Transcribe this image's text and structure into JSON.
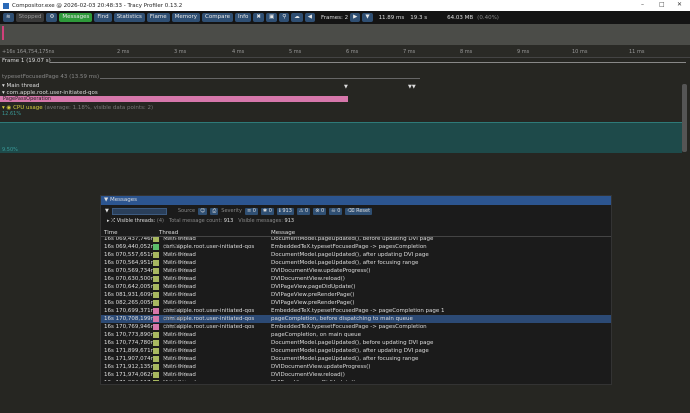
{
  "window": {
    "title": "Compositor.exe @ 2026-02-03 20:48:33 - Tracy Profiler 0.13.2",
    "minimize": "–",
    "maximize": "□",
    "close": "✕"
  },
  "toolbar": {
    "stopped": "Stopped",
    "messages": "Messages",
    "find": "Find",
    "statistics": "Statistics",
    "flame": "Flame",
    "memory": "Memory",
    "compare": "Compare",
    "info": "Info",
    "frames": "Frames: 2",
    "frame_time": "11.89 ms",
    "total_time": "19.3 s",
    "memory_usage": "64.03 MB",
    "memory_pct": "(0.40%)"
  },
  "timeline": {
    "ruler_start": "+16s 164,754,175ns",
    "ticks": [
      "2 ms",
      "3 ms",
      "4 ms",
      "5 ms",
      "6 ms",
      "7 ms",
      "8 ms",
      "9 ms",
      "10 ms",
      "11 ms"
    ],
    "frame": "Frame 1 (19.07 s)",
    "zone": "typesetFocusedPage 43 (13.59 ms)",
    "threads": [
      "Main thread",
      "com.apple.root.user-initiated-qos"
    ],
    "bar_label": "PagePassOperation",
    "cpu_label": "CPU usage",
    "cpu_info": "(average: 1.18%, visible data points: 2)",
    "cpu_top": "12.61%",
    "cpu_bottom": "9.50%",
    "colors": {
      "zone": "#d677ab",
      "cpu": "#1e4a4a"
    }
  },
  "messages": {
    "title": "Messages",
    "source_label": "Source",
    "severity_label": "Severity",
    "severity_counts": [
      "0",
      "0",
      "913",
      "0",
      "0",
      "0"
    ],
    "reset": "Reset",
    "visible_threads_label": "Visible threads:",
    "visible_threads": "(4)",
    "total_label": "Total message count:",
    "total": "913",
    "visible_label": "Visible messages:",
    "visible": "913",
    "columns": [
      "Time",
      "Thread",
      "Message"
    ],
    "rows": [
      {
        "time": "16s 069,437,746ns",
        "thread": "Main thread",
        "tid": "(27,544)",
        "msg": "DocumentModel.pageUpdated(), before updating DVI page",
        "c": "#a8b860"
      },
      {
        "time": "16s 069,440,052ns",
        "thread": "com.apple.root.user-initiated-qos",
        "tid": "(9,720)",
        "msg": "EmbeddedTeX.typesetFocusedPage -> pagesCompletion",
        "c": "#5cbc6a"
      },
      {
        "time": "16s 070,557,651ns",
        "thread": "Main thread",
        "tid": "(27,544)",
        "msg": "DocumentModel.pageUpdated(), after updating DVI page",
        "c": "#a8b860"
      },
      {
        "time": "16s 070,564,951ns",
        "thread": "Main thread",
        "tid": "(27,544)",
        "msg": "DocumentModel.pageUpdated(), after focusing range",
        "c": "#a8b860"
      },
      {
        "time": "16s 070,569,734ns",
        "thread": "Main thread",
        "tid": "(27,544)",
        "msg": "DVIDocumentView.updateProgress()",
        "c": "#a8b860"
      },
      {
        "time": "16s 070,630,500ns",
        "thread": "Main thread",
        "tid": "(27,544)",
        "msg": "DVIDocumentView.reload()",
        "c": "#a8b860"
      },
      {
        "time": "16s 070,642,005ns",
        "thread": "Main thread",
        "tid": "(27,544)",
        "msg": "DVIPageView.pageDidUpdate()",
        "c": "#a8b860"
      },
      {
        "time": "16s 081,931,609ns",
        "thread": "Main thread",
        "tid": "(27,544)",
        "msg": "DVIPageView.preRenderPage()",
        "c": "#a8b860"
      },
      {
        "time": "16s 082,265,005ns",
        "thread": "Main thread",
        "tid": "(27,544)",
        "msg": "DVIPageView.preRenderPage()",
        "c": "#a8b860"
      },
      {
        "time": "16s 170,699,371ns",
        "thread": "com.apple.root.user-initiated-qos",
        "tid": "(26,548)",
        "msg": "EmbeddedTeX.typesetFocusedPage -> pageCompletion page 1",
        "c": "#d677ab"
      },
      {
        "time": "16s 170,708,199ns",
        "thread": "com.apple.root.user-initiated-qos",
        "tid": "(26,548)",
        "msg": "pageCompletion, before dispatching to main queue",
        "c": "#d677ab",
        "selected": true
      },
      {
        "time": "16s 170,769,946ns",
        "thread": "com.apple.root.user-initiated-qos",
        "tid": "(26,548)",
        "msg": "EmbeddedTeX.typesetFocusedPage -> pagesCompletion",
        "c": "#d677ab"
      },
      {
        "time": "16s 170,773,890ns",
        "thread": "Main thread",
        "tid": "(27,544)",
        "msg": "pageCompletion, on main queue",
        "c": "#a8b860"
      },
      {
        "time": "16s 170,774,780ns",
        "thread": "Main thread",
        "tid": "(27,544)",
        "msg": "DocumentModel.pageUpdated(), before updating DVI page",
        "c": "#a8b860"
      },
      {
        "time": "16s 171,899,671ns",
        "thread": "Main thread",
        "tid": "(27,544)",
        "msg": "DocumentModel.pageUpdated(), after updating DVI page",
        "c": "#a8b860"
      },
      {
        "time": "16s 171,907,074ns",
        "thread": "Main thread",
        "tid": "(27,544)",
        "msg": "DocumentModel.pageUpdated(), after focusing range",
        "c": "#a8b860"
      },
      {
        "time": "16s 171,912,135ns",
        "thread": "Main thread",
        "tid": "(27,544)",
        "msg": "DVIDocumentView.updateProgress()",
        "c": "#a8b860"
      },
      {
        "time": "16s 171,974,062ns",
        "thread": "Main thread",
        "tid": "(27,544)",
        "msg": "DVIDocumentView.reload()",
        "c": "#a8b860"
      },
      {
        "time": "16s 171,984,117ns",
        "thread": "Main thread",
        "tid": "(27,544)",
        "msg": "DVIPageView.pageDidUpdate()",
        "c": "#a8b860"
      }
    ]
  }
}
